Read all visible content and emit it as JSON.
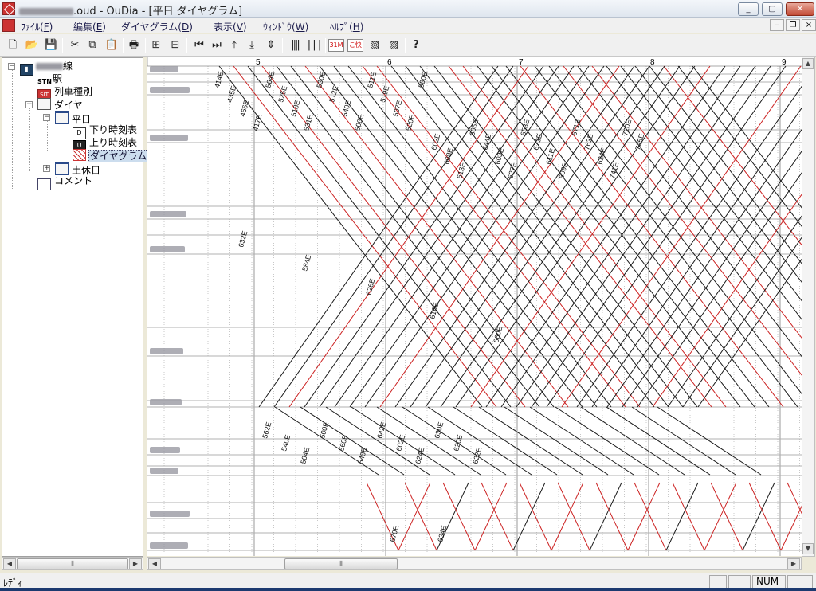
{
  "window": {
    "title": ".oud - OuDia - [平日 ダイヤグラム]",
    "minimize_label": "_",
    "maximize_label": "▢",
    "close_label": "✕"
  },
  "menu": {
    "items": [
      {
        "label": "ﾌｧｲﾙ(",
        "key": "F",
        "suffix": ")"
      },
      {
        "label": "編集(",
        "key": "E",
        "suffix": ")"
      },
      {
        "label": "ダイヤグラム(",
        "key": "D",
        "suffix": ")"
      },
      {
        "label": "表示(",
        "key": "V",
        "suffix": ")"
      },
      {
        "label": "ｳｨﾝﾄﾞｳ(",
        "key": "W",
        "suffix": ")"
      },
      {
        "label": "ﾍﾙﾌﾟ(",
        "key": "H",
        "suffix": ")"
      }
    ],
    "mdi_min": "–",
    "mdi_restore": "❐",
    "mdi_close": "×"
  },
  "toolbar": {
    "icons": [
      "new-file-icon",
      "open-folder-icon",
      "save-icon",
      "cut-icon",
      "copy-icon",
      "paste-icon",
      "print-icon",
      "diagram-zoom-a-icon",
      "diagram-zoom-b-icon",
      "first-icon",
      "last-icon",
      "align-top-icon",
      "align-bottom-icon",
      "align-center-icon",
      "time-lines-a-icon",
      "time-lines-b-icon",
      "train-number-icon",
      "train-name-icon",
      "down-trains-icon",
      "up-trains-icon",
      "help-icon"
    ],
    "train_number_badge": "31M",
    "train_name_badge": "こ快"
  },
  "tree": {
    "line_suffix": "線",
    "station": "駅",
    "train_types": "列車種別",
    "dia": "ダイヤ",
    "weekday": "平日",
    "down_timetable": "下り時刻表",
    "up_timetable": "上り時刻表",
    "diagram": "ダイヤグラム",
    "holiday": "土休日",
    "comment": "コメント",
    "station_icon_text": "STN",
    "train_type_icon_text": "SIT",
    "down_icon_text": "D",
    "up_icon_text": "U"
  },
  "diagram": {
    "hour_labels": [
      "5",
      "6",
      "7",
      "8",
      "9"
    ],
    "train_labels": [
      "414E",
      "435E",
      "466E",
      "417E",
      "564E",
      "525E",
      "518E",
      "531E",
      "530E",
      "512E",
      "540E",
      "506E",
      "511E",
      "519E",
      "507E",
      "520E",
      "580E",
      "602E",
      "608E",
      "613E",
      "606E",
      "644E",
      "603E",
      "627E",
      "653E",
      "673E",
      "611E",
      "609E",
      "671E",
      "763E",
      "624E",
      "741E",
      "720E",
      "725E",
      "632E",
      "584E",
      "626E",
      "616E",
      "660E",
      "562E",
      "540E",
      "504E",
      "500E",
      "560E",
      "548E",
      "642E",
      "602E",
      "624E",
      "630E",
      "620E",
      "622E",
      "670E",
      "634E"
    ],
    "colors": {
      "black_train": "#1a1a1a",
      "red_train": "#cc2222",
      "grid_major": "#9a9a9a",
      "grid_minor": "#c8c8c8",
      "station_line": "#b0b0b0"
    }
  },
  "status": {
    "text": "ﾚﾃﾞｨ",
    "num": "NUM"
  }
}
